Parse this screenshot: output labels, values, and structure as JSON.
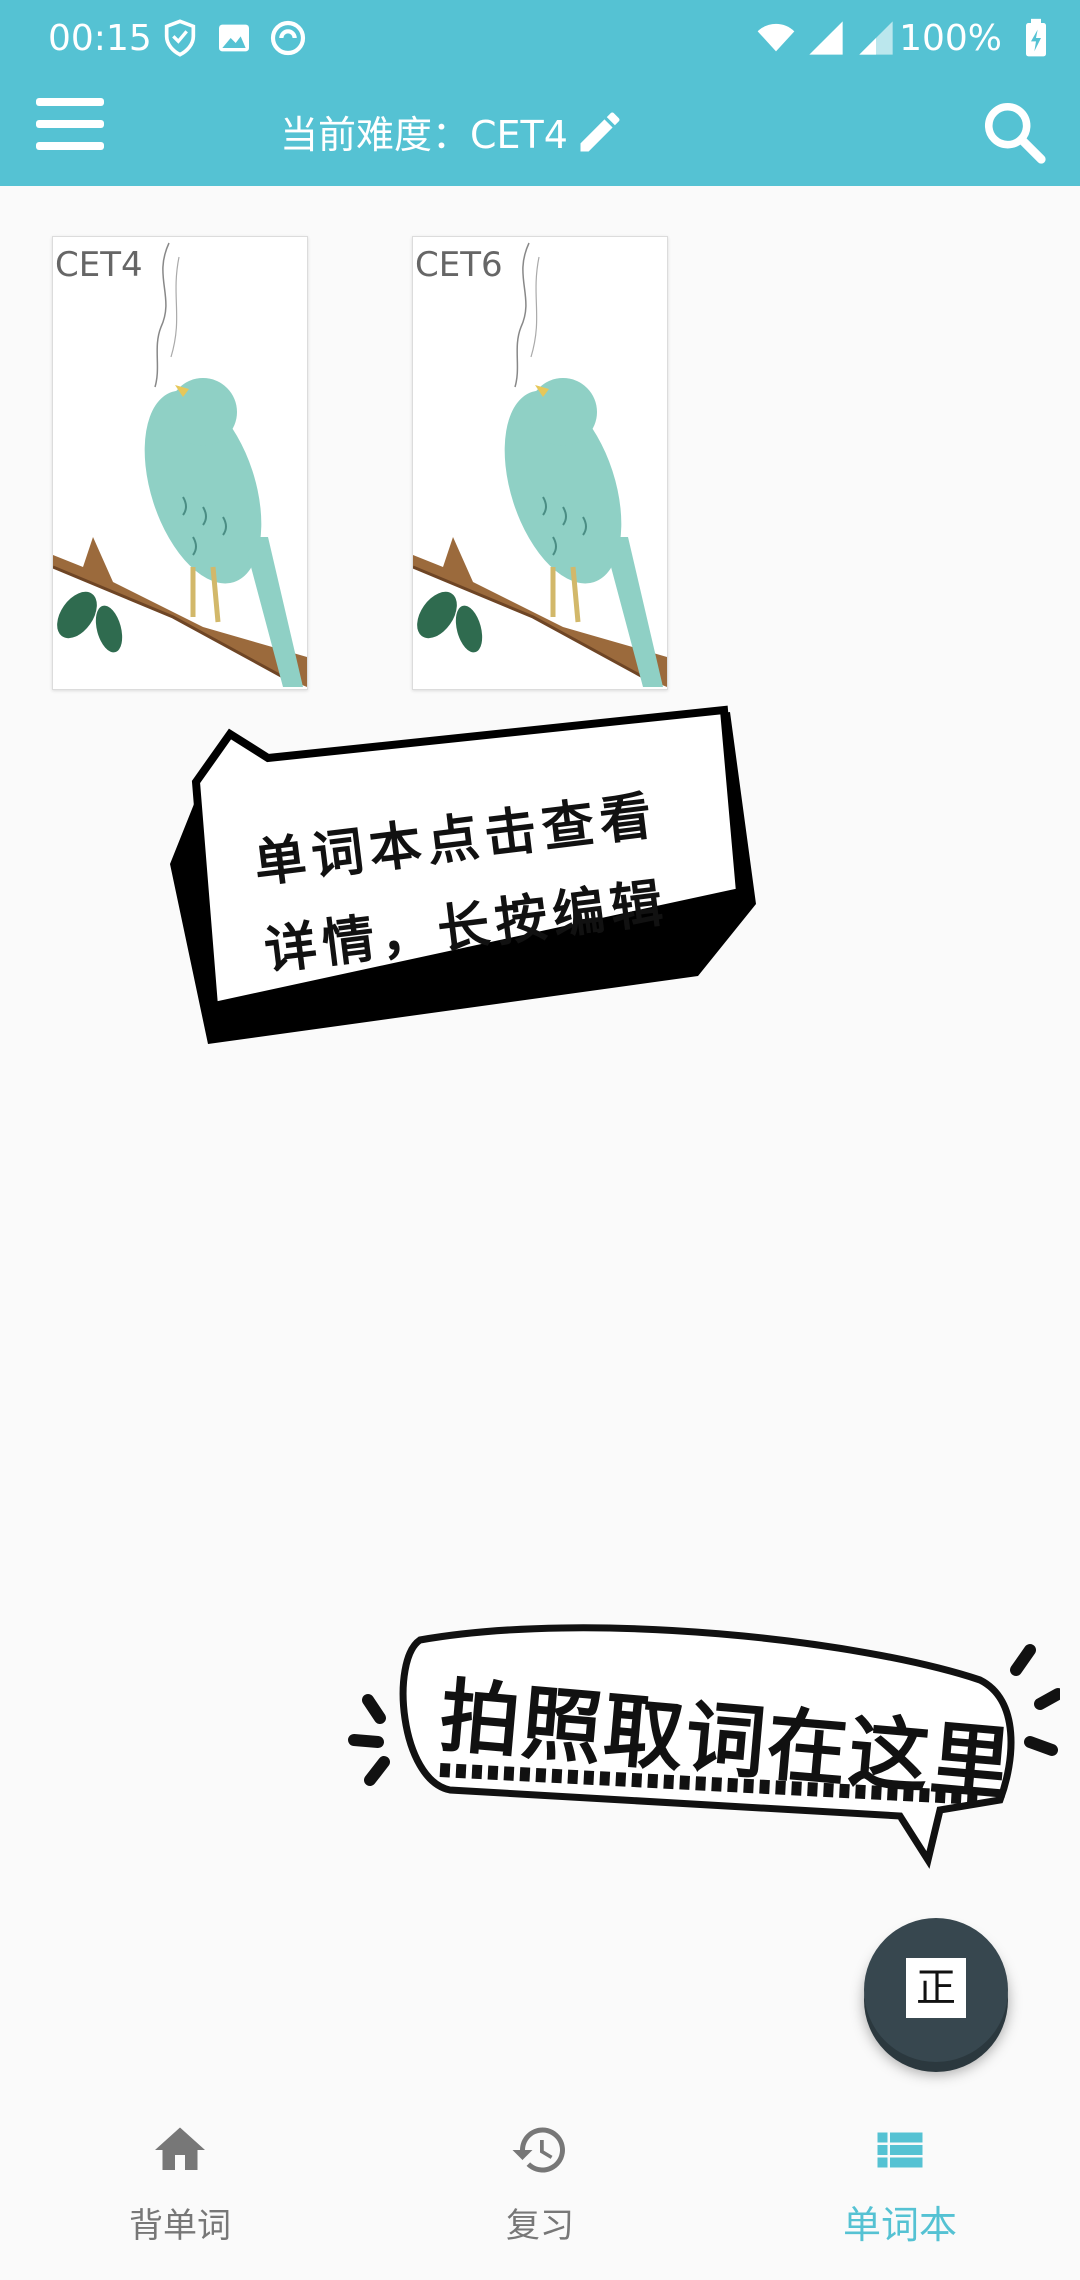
{
  "status_bar": {
    "time": "00:15",
    "battery": "100%",
    "icons": [
      "shield-icon",
      "image-icon",
      "sync-icon",
      "wifi-icon",
      "signal-icon",
      "signal-icon",
      "battery-icon"
    ]
  },
  "toolbar": {
    "title": "当前难度：CET4",
    "icons": [
      "menu-icon",
      "edit-icon",
      "search-icon"
    ]
  },
  "wordbooks": [
    {
      "label": "CET4"
    },
    {
      "label": "CET6"
    }
  ],
  "hints": {
    "wordbook_tip_line1": "单词本点击查看",
    "wordbook_tip_line2": "详情，长按编辑",
    "photo_tip": "拍照取词在这里"
  },
  "fab": {
    "glyph": "正"
  },
  "bottom_nav": {
    "items": [
      {
        "label": "背单词",
        "icon": "home-icon",
        "active": false
      },
      {
        "label": "复习",
        "icon": "history-icon",
        "active": false
      },
      {
        "label": "单词本",
        "icon": "list-icon",
        "active": true
      }
    ]
  },
  "colors": {
    "primary": "#55c2d3",
    "fab": "#37474f",
    "inactive_nav": "#777777"
  }
}
